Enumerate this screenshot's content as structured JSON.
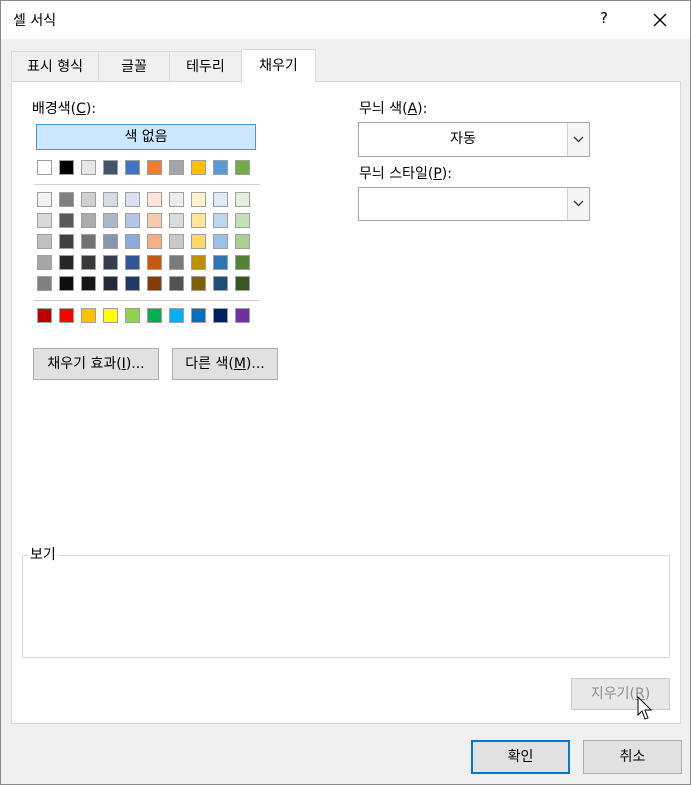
{
  "window": {
    "title": "셀 서식",
    "help": "?"
  },
  "tabs": [
    {
      "label": "표시 형식",
      "active": false
    },
    {
      "label": "글꼴",
      "active": false
    },
    {
      "label": "테두리",
      "active": false
    },
    {
      "label": "채우기",
      "active": true
    }
  ],
  "fill": {
    "bg_label": "배경색(",
    "bg_key": "C",
    "bg_suffix": "):",
    "no_color": "색 없음",
    "theme_top": [
      "#ffffff",
      "#000000",
      "#e7e6e6",
      "#44546a",
      "#4472c4",
      "#ed7d31",
      "#a5a5a5",
      "#ffc000",
      "#5b9bd5",
      "#70ad47"
    ],
    "theme_shades": [
      [
        "#f2f2f2",
        "#7f7f7f",
        "#d0cece",
        "#d6dce4",
        "#d9e1f2",
        "#fce4d6",
        "#ededed",
        "#fff2cc",
        "#ddebf7",
        "#e2efda"
      ],
      [
        "#d9d9d9",
        "#595959",
        "#aeaaaa",
        "#acb9ca",
        "#b4c6e7",
        "#f8cbad",
        "#dbdbdb",
        "#ffe699",
        "#bdd7ee",
        "#c6e0b4"
      ],
      [
        "#bfbfbf",
        "#404040",
        "#757171",
        "#8497b0",
        "#8ea9db",
        "#f4b084",
        "#c9c9c9",
        "#ffd966",
        "#9bc2e6",
        "#a9d08e"
      ],
      [
        "#a6a6a6",
        "#262626",
        "#3a3838",
        "#333f4f",
        "#2f5597",
        "#c65911",
        "#7b7b7b",
        "#bf8f00",
        "#2e75b6",
        "#548235"
      ],
      [
        "#808080",
        "#0d0d0d",
        "#161616",
        "#222b35",
        "#203864",
        "#843c0c",
        "#525252",
        "#7f6000",
        "#1f4e78",
        "#375623"
      ]
    ],
    "standard": [
      "#c00000",
      "#ff0000",
      "#ffc000",
      "#ffff00",
      "#92d050",
      "#00b050",
      "#00b0f0",
      "#0070c0",
      "#002060",
      "#7030a0"
    ],
    "effects_btn": {
      "text": "채우기 효과(",
      "key": "I",
      "suffix": ")..."
    },
    "more_btn": {
      "text": "다른 색(",
      "key": "M",
      "suffix": ")..."
    }
  },
  "pattern": {
    "color_label": "무늬 색(",
    "color_key": "A",
    "color_suffix": "):",
    "color_value": "자동",
    "style_label": "무늬 스타일(",
    "style_key": "P",
    "style_suffix": "):",
    "style_value": ""
  },
  "preview": {
    "label": "보기"
  },
  "clear_btn": {
    "text": "지우기(",
    "key": "R",
    "suffix": ")"
  },
  "ok_btn": "확인",
  "cancel_btn": "취소"
}
